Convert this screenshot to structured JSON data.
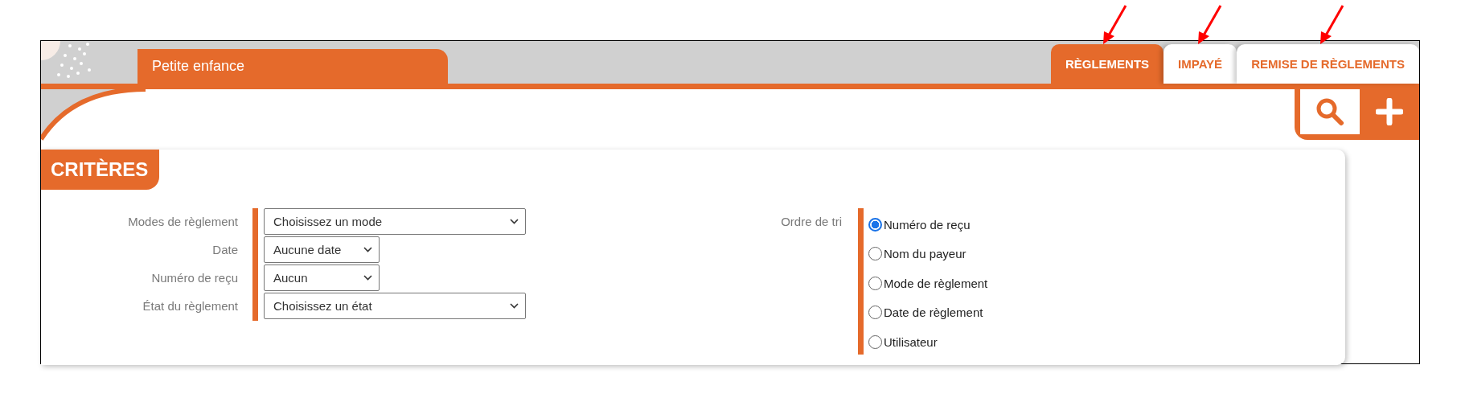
{
  "header": {
    "section": "Petite enfance"
  },
  "tabs": [
    {
      "label": "RÈGLEMENTS",
      "selected": true,
      "marked": true
    },
    {
      "label": "IMPAYÉ",
      "selected": false,
      "marked": true
    },
    {
      "label": "REMISE DE RÈGLEMENTS",
      "selected": false,
      "marked": true
    }
  ],
  "toolbar": [
    {
      "kind": "search",
      "selected": true
    },
    {
      "kind": "add",
      "selected": false
    }
  ],
  "criteria": {
    "title": "CRITÈRES",
    "filters": [
      {
        "label": "Modes de règlement",
        "value": "Choisissez un mode",
        "kind": "wide"
      },
      {
        "label": "Date",
        "value": "Aucune date",
        "kind": "narrow"
      },
      {
        "label": "Numéro de reçu",
        "value": "Aucun",
        "kind": "narrow"
      },
      {
        "label": "État du règlement",
        "value": "Choisissez un état",
        "kind": "wide"
      }
    ],
    "sort": {
      "label": "Ordre de tri",
      "options": [
        {
          "label": "Numéro de reçu",
          "selected": true
        },
        {
          "label": "Nom du payeur",
          "selected": false
        },
        {
          "label": "Mode de règlement",
          "selected": false
        },
        {
          "label": "Date de règlement",
          "selected": false
        },
        {
          "label": "Utilisateur",
          "selected": false
        }
      ]
    }
  }
}
